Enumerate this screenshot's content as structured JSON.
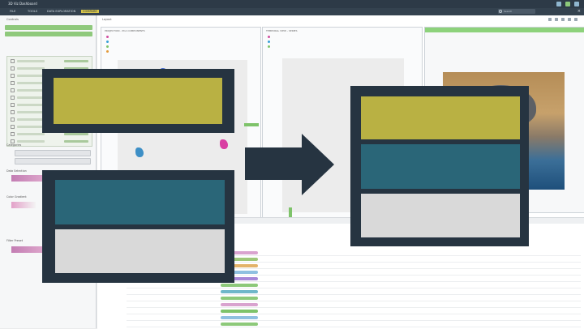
{
  "window": {
    "app_title": "3D Viz Dashboard",
    "version": ""
  },
  "menu": {
    "items": [
      "FILE",
      "TOOLS",
      "DATA EXPLORATION",
      "COMPARE"
    ],
    "active_index": 3,
    "search_placeholder": "Search"
  },
  "left_panel": {
    "title": "Controls",
    "sections": [
      "Categories",
      "Data Selection",
      "Color Gradient",
      "Filter Preset"
    ]
  },
  "workspace": {
    "tab_label": "Layout"
  },
  "plots": [
    {
      "header": "PROJECTION - PCA COMPONENTS"
    },
    {
      "header": "TEMPORAL VIEW - SERIES"
    }
  ],
  "colors": {
    "olive": "#b9b143",
    "teal": "#2a6678",
    "light_gray": "#d9d9d9",
    "dark_frame": "#263441",
    "accent_green": "#7ec36a"
  },
  "diagram": {
    "left_top_blocks": [
      "olive"
    ],
    "left_bottom_blocks": [
      "teal",
      "light_gray"
    ],
    "right_blocks": [
      "olive",
      "teal",
      "light_gray"
    ],
    "arrow": "right"
  }
}
